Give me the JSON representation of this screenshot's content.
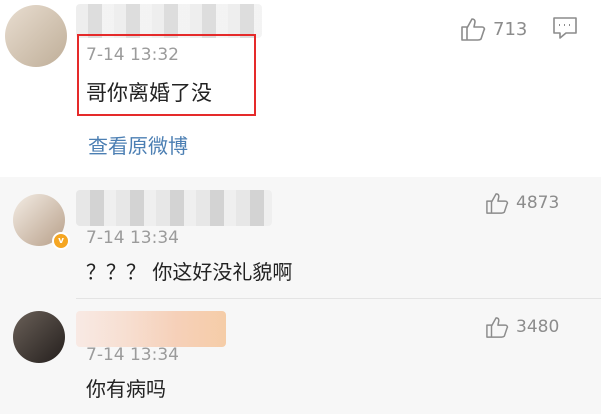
{
  "main_comment": {
    "date": "7-14 13:32",
    "text": "哥你离婚了没",
    "likes": "713",
    "view_original_label": "查看原微博"
  },
  "replies": [
    {
      "date": "7-14 13:34",
      "text": "？？？ 你这好没礼貌啊",
      "likes": "4873"
    },
    {
      "date": "7-14 13:34",
      "text": "你有病吗",
      "likes": "3480"
    }
  ]
}
